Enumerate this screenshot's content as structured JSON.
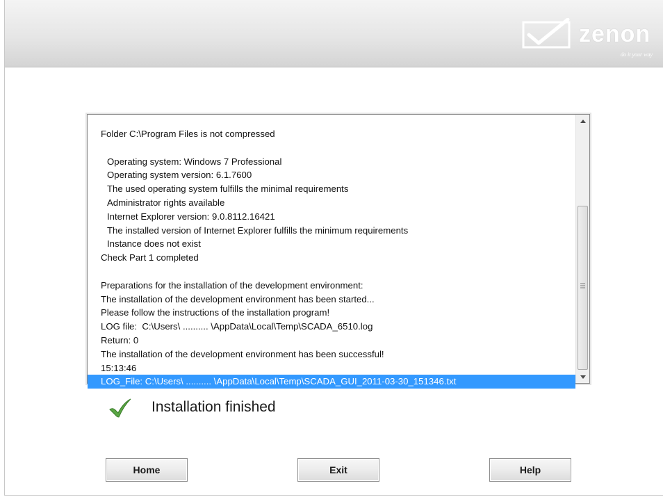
{
  "brand": {
    "name": "zenon",
    "tagline": "do it your way",
    "logo_icon": "checkmark-logo-icon"
  },
  "log": {
    "lines": [
      {
        "text": "Folder C:\\Program Files is not compressed",
        "indent": false
      },
      {
        "text": "",
        "indent": false
      },
      {
        "text": "Operating system: Windows 7 Professional",
        "indent": true
      },
      {
        "text": "Operating system version: 6.1.7600",
        "indent": true
      },
      {
        "text": "The used operating system fulfills the minimal requirements",
        "indent": true
      },
      {
        "text": "Administrator rights available",
        "indent": true
      },
      {
        "text": "Internet Explorer version: 9.0.8112.16421",
        "indent": true
      },
      {
        "text": "The installed version of Internet Explorer fulfills the minimum requirements",
        "indent": true
      },
      {
        "text": "Instance does not exist",
        "indent": true
      },
      {
        "text": "Check Part 1 completed",
        "indent": false
      },
      {
        "text": "",
        "indent": false
      },
      {
        "text": "Preparations for the installation of the development environment:",
        "indent": false
      },
      {
        "text": "The installation of the development environment has been started...",
        "indent": false
      },
      {
        "text": "Please follow the instructions of the installation program!",
        "indent": false
      },
      {
        "text": "LOG file:  C:\\Users\\ .......... \\AppData\\Local\\Temp\\SCADA_6510.log",
        "indent": false
      },
      {
        "text": "Return: 0",
        "indent": false
      },
      {
        "text": "The installation of the development environment has been successful!",
        "indent": false
      },
      {
        "text": "15:13:46",
        "indent": false
      },
      {
        "text": "LOG_File: C:\\Users\\ .......... \\AppData\\Local\\Temp\\SCADA_GUI_2011-03-30_151346.txt",
        "indent": false,
        "selected": true
      }
    ],
    "selection_color": "#3399ff"
  },
  "status": {
    "text": "Installation finished",
    "icon": "green-check-icon",
    "icon_color": "#4f9a3a"
  },
  "buttons": {
    "home": "Home",
    "exit": "Exit",
    "help": "Help"
  }
}
